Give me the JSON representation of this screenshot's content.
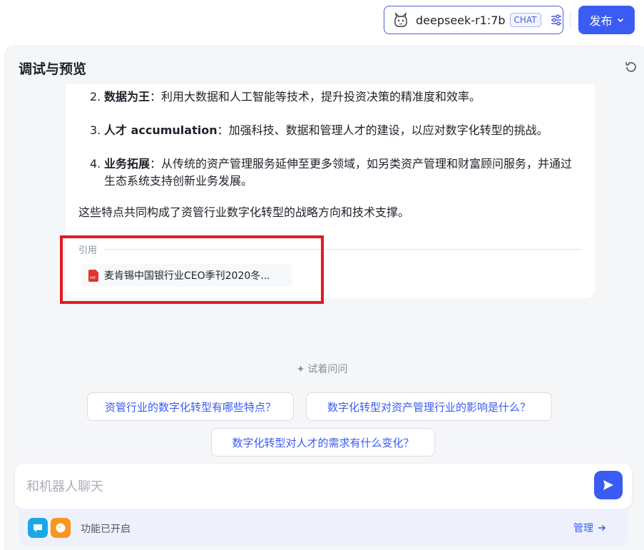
{
  "header": {
    "model_name": "deepseek-r1:7b",
    "model_tag": "CHAT",
    "publish_label": "发布"
  },
  "panel": {
    "title": "调试与预览"
  },
  "message": {
    "items": [
      {
        "num": "2.",
        "bold": "数据为王",
        "text": "：利用大数据和人工智能等技术，提升投资决策的精准度和效率。"
      },
      {
        "num": "3.",
        "bold": "人才 accumulation",
        "text": "：加强科技、数据和管理人才的建设，以应对数字化转型的挑战。"
      },
      {
        "num": "4.",
        "bold": "业务拓展",
        "text": "：从传统的资产管理服务延伸至更多领域，如另类资产管理和财富顾问服务，并通过生态系统支持创新业务发展。"
      }
    ],
    "summary": "这些特点共同构成了资管行业数字化转型的战略方向和技术支撑。",
    "citation_label": "引用",
    "citation_file": "麦肯锡中国银行业CEO季刊2020冬..."
  },
  "suggestions": {
    "title": "试着问问",
    "items": [
      "资管行业的数字化转型有哪些特点？",
      "数字化转型对资产管理行业的影响是什么？",
      "数字化转型对人才的需求有什么变化？"
    ]
  },
  "composer": {
    "placeholder": "和机器人聊天"
  },
  "feature_bar": {
    "status": "功能已开启",
    "manage_label": "管理"
  },
  "colors": {
    "accent": "#3a5cf2",
    "highlight": "#e11c23",
    "icon_blue": "#1aa7e8",
    "icon_orange": "#f7971e"
  }
}
